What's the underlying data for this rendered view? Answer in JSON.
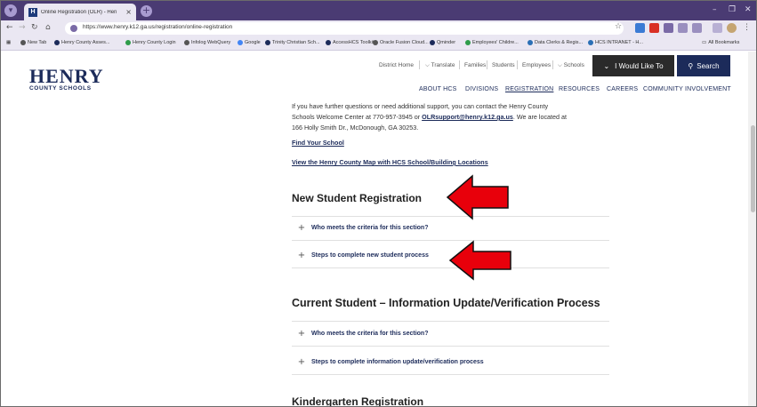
{
  "browser": {
    "tab_title": "Online Registration (OLR) - Hen",
    "tab_favicon": "H",
    "url": "https://www.henry.k12.ga.us/registration/online-registration",
    "bookmarks": [
      "New Tab",
      "Henry County Asses...",
      "Henry County Login",
      "Infolog WebQuery",
      "Google",
      "Trinity Christian Sch...",
      "AccessHCS Toolkit",
      "Oracle Fusion Cloud...",
      "Qminder",
      "Employees' Childre...",
      "Data Clerks & Regis...",
      "HCS INTRANET - H..."
    ],
    "all_bookmarks": "All Bookmarks"
  },
  "site": {
    "logo_main": "HENRY",
    "logo_sub": "COUNTY SCHOOLS",
    "utility_nav": [
      "District Home",
      "Translate",
      "Families",
      "Students",
      "Employees",
      "Schools"
    ],
    "i_would_like": "I Would Like To",
    "search": "Search",
    "main_nav": [
      "ABOUT HCS",
      "DIVISIONS",
      "REGISTRATION",
      "RESOURCES",
      "CAREERS",
      "COMMUNITY INVOLVEMENT"
    ],
    "active_nav": "REGISTRATION"
  },
  "content": {
    "para_line1": "If you have further questions or need additional support, you can contact the Henry County",
    "para_line2_a": "Schools Welcome Center at 770-957-3945 or ",
    "para_email": "OLRsupport@henry.k12.ga.us",
    "para_line2_b": ". We are located at",
    "para_line3": "166 Holly Smith Dr., McDonough, GA 30253.",
    "link_find_school": "Find Your School",
    "link_map": "View the Henry County Map with HCS School/Building Locations",
    "section1_heading": "New Student Registration",
    "section1_items": [
      "Who meets the criteria for this section?",
      "Steps to complete new student process"
    ],
    "section2_heading": "Current Student – Information Update/Verification Process",
    "section2_items": [
      "Who meets the criteria for this section?",
      "Steps to complete information update/verification process"
    ],
    "section3_heading": "Kindergarten Registration"
  },
  "colors": {
    "brand_navy": "#1c2b5a",
    "chrome_purple": "#4a3b73",
    "arrow_red": "#e8000b"
  }
}
